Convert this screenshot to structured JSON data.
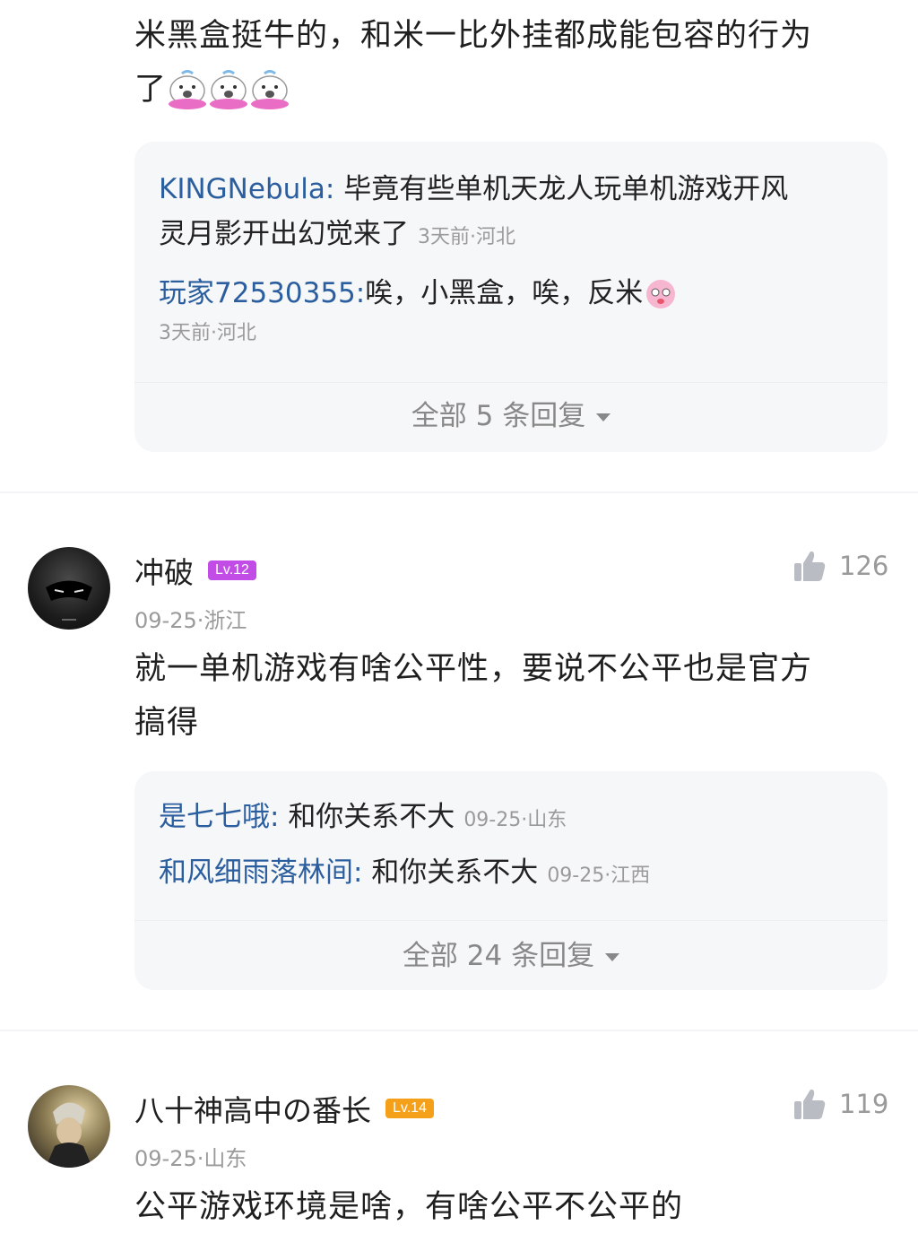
{
  "comment0": {
    "text_line1": "米黑盒挺牛的，和米一比外挂都成能包容的行为",
    "text_line2": "了",
    "replies": [
      {
        "name": "KINGNebula",
        "text_a": "毕竟有些单机天龙人玩单机游戏开风",
        "text_b": "灵月影开出幻觉来了",
        "meta": "3天前·河北"
      },
      {
        "name": "玩家72530355",
        "text": "唉，小黑盒，唉，反米",
        "meta": "3天前·河北"
      }
    ],
    "expand_label": "全部 5 条回复"
  },
  "comment1": {
    "username": "冲破",
    "level": "Lv.12",
    "level_color": "#c14ce6",
    "likes": "126",
    "meta": "09-25·浙江",
    "text_line1": "就一单机游戏有啥公平性，要说不公平也是官方",
    "text_line2": "搞得",
    "replies": [
      {
        "name": "是七七哦",
        "text": "和你关系不大",
        "meta": "09-25·山东"
      },
      {
        "name": "和风细雨落林间",
        "text": "和你关系不大",
        "meta": "09-25·江西"
      }
    ],
    "expand_label": "全部 24 条回复"
  },
  "comment2": {
    "username": "八十神高中の番长",
    "level": "Lv.14",
    "level_color": "#f5a01a",
    "likes": "119",
    "meta": "09-25·山东",
    "text_line1": "公平游戏环境是啥，有啥公平不公平的"
  },
  "icons": {
    "like": "thumbs-up-icon",
    "expand": "caret-down-icon",
    "emoji": "sticker-emoji-icon"
  }
}
